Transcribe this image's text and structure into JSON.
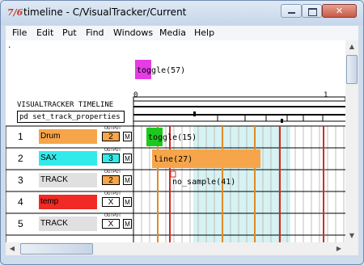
{
  "window": {
    "title": "timeline - C/VisualTracker/Current",
    "app_icon": "pd-icon"
  },
  "menubar": [
    "File",
    "Edit",
    "Put",
    "Find",
    "Windows",
    "Media",
    "Help"
  ],
  "canvas": {
    "dot": ".",
    "toggle_top": "toggle(57)",
    "ruler_start": "0",
    "ruler_end": "1",
    "timeline_title": "VISUALTRACKER TIMELINE",
    "set_props": "pd set_track_properties",
    "output_label": "OUTPUT",
    "tracks": [
      {
        "num": "1",
        "name": "Drum",
        "color": "#f6a54a",
        "out": "2",
        "out_bg": "#f6a54a",
        "m": "M"
      },
      {
        "num": "2",
        "name": "SAX",
        "color": "#33eaea",
        "out": "3",
        "out_bg": "#33eaea",
        "m": "M"
      },
      {
        "num": "3",
        "name": "TRACK",
        "color": "#e0e0e0",
        "out": "2",
        "out_bg": "#f6a54a",
        "m": "M"
      },
      {
        "num": "4",
        "name": "temp",
        "color": "#f02a24",
        "out": "X",
        "out_bg": "#ffffff",
        "m": "M"
      },
      {
        "num": "5",
        "name": "TRACK",
        "color": "#e0e0e0",
        "out": "X",
        "out_bg": "#ffffff",
        "m": "M"
      }
    ],
    "events": {
      "toggle15": "toggle(15)",
      "line27": "line(27)",
      "nosample": "no_sample(41)"
    }
  },
  "colors": {
    "toggle_magenta": "#e63ce6",
    "toggle_green": "#1ec81e",
    "line_orange": "#f6a54a",
    "highlight_cyan": "#d6f2f2",
    "marker_red": "#d8281e",
    "marker_orange": "#e08a2a"
  }
}
